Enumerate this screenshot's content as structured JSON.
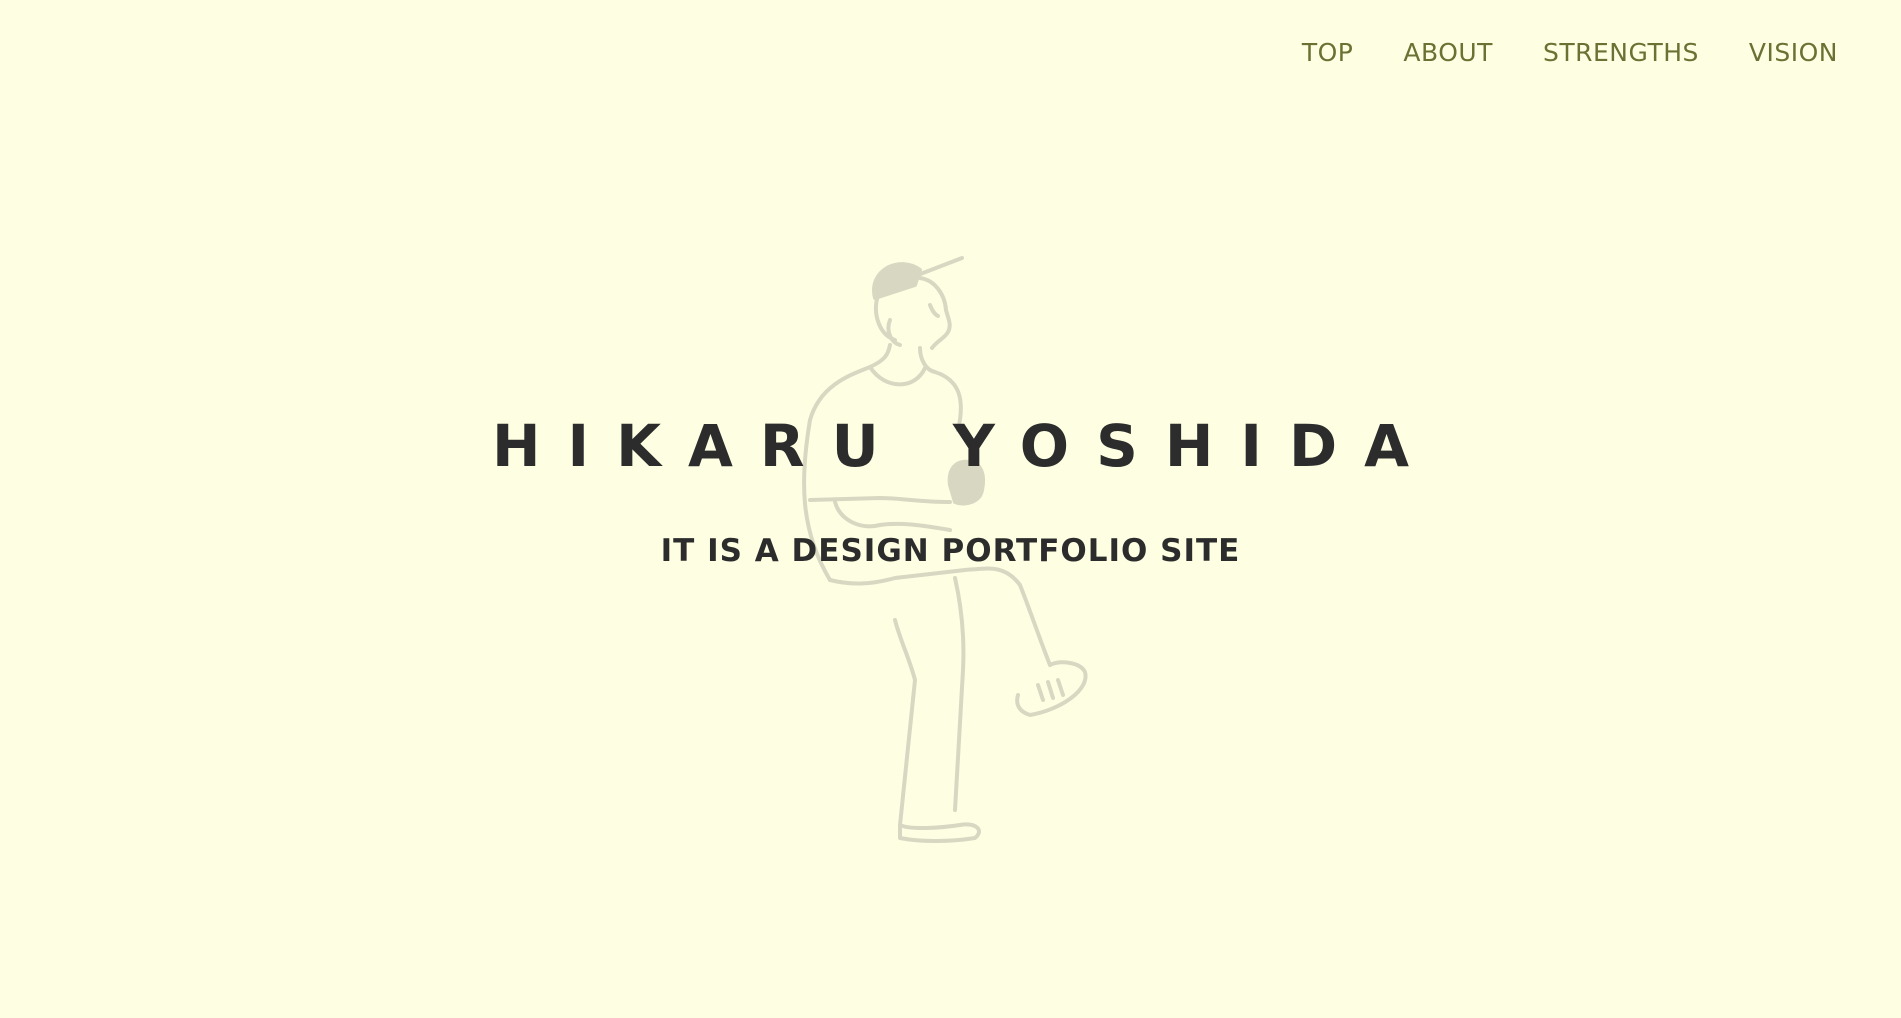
{
  "nav": {
    "items": [
      {
        "label": "TOP"
      },
      {
        "label": "ABOUT"
      },
      {
        "label": "STRENGTHS"
      },
      {
        "label": "VISION"
      }
    ]
  },
  "hero": {
    "title": "HIKARU YOSHIDA",
    "subtitle": "IT IS A DESIGN PORTFOLIO SITE",
    "illustration_icon": "seated-person-with-cup-illustration"
  },
  "colors": {
    "background": "#fefee3",
    "nav_text": "#6b7132",
    "title_text": "#2c2c2c",
    "illustration_stroke": "#d8d8c2"
  }
}
